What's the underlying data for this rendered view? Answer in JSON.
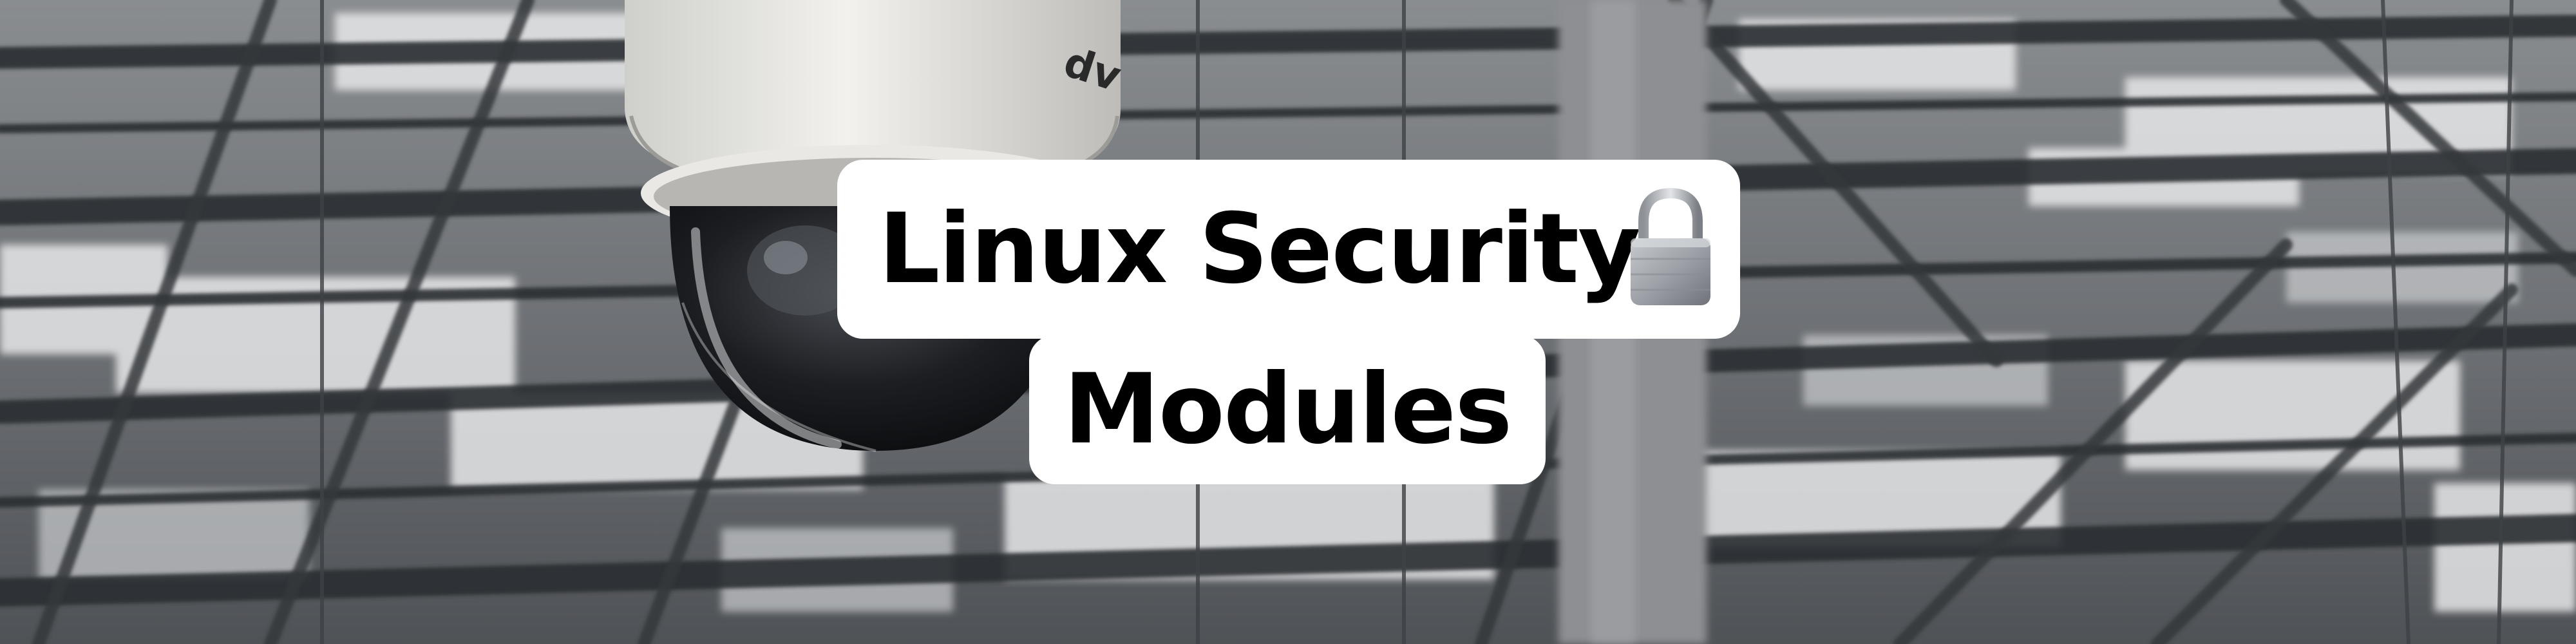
{
  "banner": {
    "title_line_1": "Linux Security",
    "title_line_2": "Modules",
    "camera_brand": "dv",
    "icons": {
      "lock": "padlock-icon"
    }
  },
  "colors": {
    "label_background": "#ffffff",
    "label_text": "#000000",
    "background_tone": "#6b6e72"
  }
}
